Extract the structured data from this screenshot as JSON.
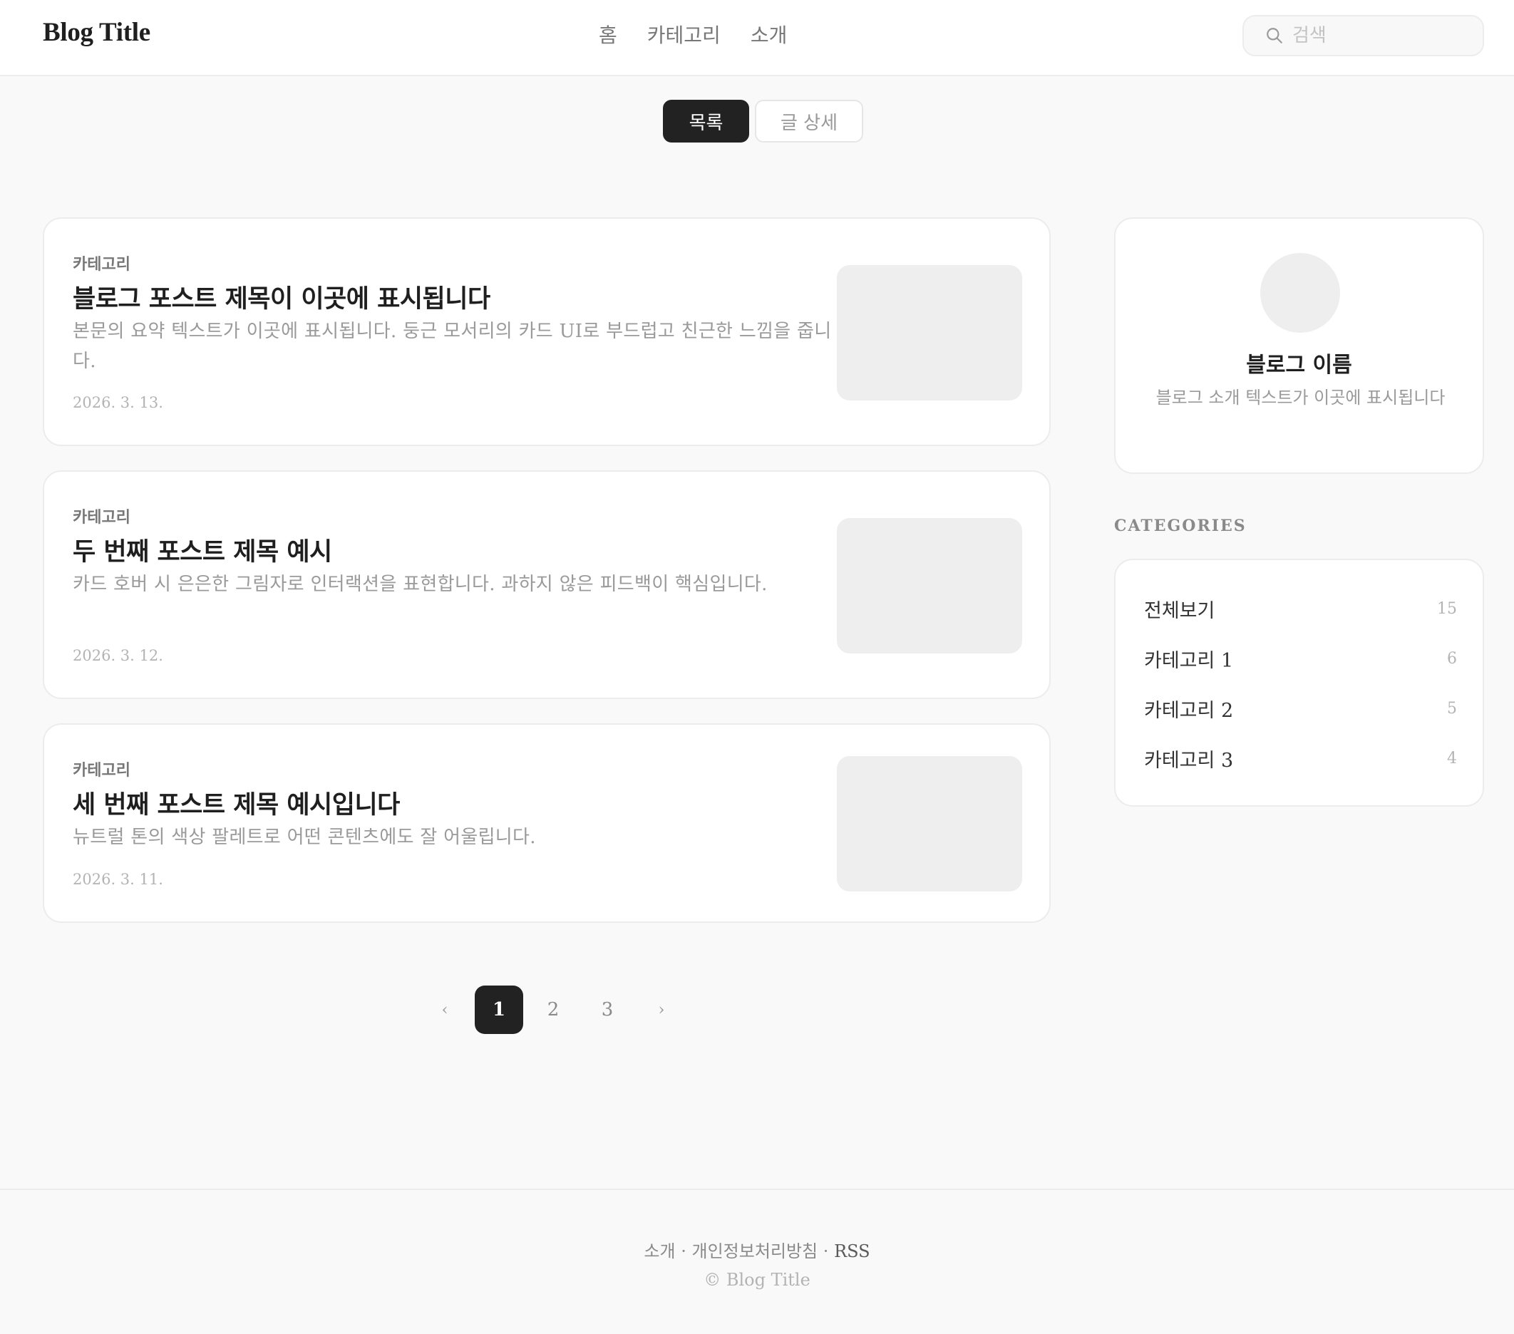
{
  "header": {
    "brand": "Blog Title",
    "nav": [
      "홈",
      "카테고리",
      "소개"
    ],
    "search_placeholder": "검색"
  },
  "view_toggle": {
    "active": "목록",
    "inactive": "글 상세"
  },
  "posts": [
    {
      "category": "카테고리",
      "title": "블로그 포스트 제목이 이곳에 표시됩니다",
      "excerpt": "본문의 요약 텍스트가 이곳에 표시됩니다. 둥근 모서리의 카드 UI로 부드럽고 친근한 느낌을 줍니다.",
      "date": "2026. 3. 13."
    },
    {
      "category": "카테고리",
      "title": "두 번째 포스트 제목 예시",
      "excerpt": "카드 호버 시 은은한 그림자로 인터랙션을 표현합니다. 과하지 않은 피드백이 핵심입니다.",
      "date": "2026. 3. 12."
    },
    {
      "category": "카테고리",
      "title": "세 번째 포스트 제목 예시입니다",
      "excerpt": "뉴트럴 톤의 색상 팔레트로 어떤 콘텐츠에도 잘 어울립니다.",
      "date": "2026. 3. 11."
    }
  ],
  "pagination": {
    "prev": "‹",
    "pages": [
      "1",
      "2",
      "3"
    ],
    "current": "1",
    "next": "›"
  },
  "profile": {
    "name": "블로그 이름",
    "description": "블로그 소개 텍스트가 이곳에 표시됩니다"
  },
  "categories": {
    "heading": "CATEGORIES",
    "items": [
      {
        "name": "전체보기",
        "count": "15"
      },
      {
        "name": "카테고리 1",
        "count": "6"
      },
      {
        "name": "카테고리 2",
        "count": "5"
      },
      {
        "name": "카테고리 3",
        "count": "4"
      }
    ]
  },
  "footer": {
    "links": [
      "소개",
      "개인정보처리방침",
      "RSS"
    ],
    "separator": "·",
    "copyright": "© Blog Title"
  },
  "colors": {
    "accent": "#222222",
    "background": "#f9f9f9",
    "card": "#ffffff",
    "muted": "#9a9a9a"
  },
  "icons": {
    "search": "search-icon"
  }
}
